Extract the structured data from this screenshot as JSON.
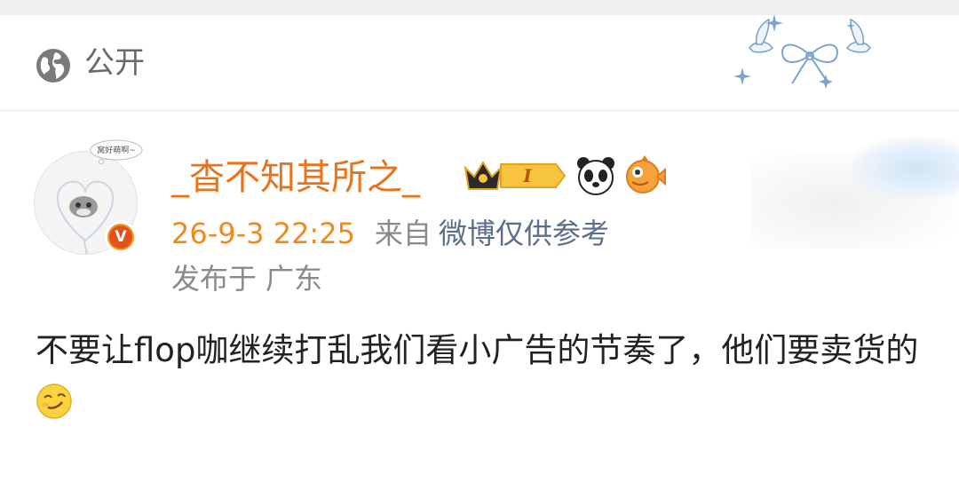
{
  "visibility": {
    "label": "公开",
    "icon": "globe-icon"
  },
  "user": {
    "name": "_杳不知其所之_",
    "avatar_bubble_text": "窝好萌啊~",
    "verified_badge": "V",
    "level_badge": "I",
    "badges": [
      "crown-level-badge",
      "panda-badge",
      "fish-badge"
    ]
  },
  "post": {
    "time": "26-9-3 22:25",
    "from_label": "来自",
    "source": "微博仅供参考",
    "region_label": "发布于",
    "region": "广东",
    "text": "不要让flop咖继续打乱我们看小广告的节奏了，他们要卖货的",
    "emoji": "smirk-emoji"
  },
  "colors": {
    "username": "#e8731a",
    "time": "#f08a1c",
    "source": "#5b6e8a",
    "muted": "#8a8a8a"
  }
}
